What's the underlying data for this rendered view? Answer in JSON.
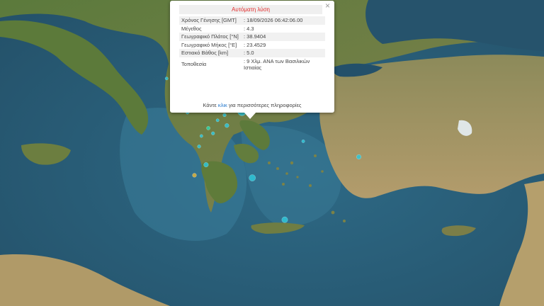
{
  "popup": {
    "title": "Αυτόματη λύση",
    "close_glyph": "×",
    "close_icon": "close-icon",
    "rows": [
      {
        "label": "Χρόνος Γένησης [GMT]",
        "value": ": 18/09/2026 06:42:06.00"
      },
      {
        "label": "Μέγεθος",
        "value": ": 4.3"
      },
      {
        "label": "Γεωγραφικό Πλάτος [°N]",
        "value": ": 38.9404"
      },
      {
        "label": "Γεωγραφικό Μήκος [°E]",
        "value": ": 23.4529"
      },
      {
        "label": "Εστιακό Βάθος [km]",
        "value": ": 5.0"
      },
      {
        "label": "Τοποθεσία",
        "value": ": 9 Χλμ. ΑΝΑ των Βασιλικών Ιστιαίας"
      }
    ],
    "more_prefix": "Κάντε ",
    "more_link": "κλικ",
    "more_suffix": " για περισσότερες πληροφορίες"
  },
  "map": {
    "colors": {
      "sea": "#3e6f88",
      "deep_sea": "#27506a",
      "land": "#5e7a3a",
      "land_light": "#a79c6e",
      "marker": "#2fc7d9",
      "marker_alt": "#e0b43c"
    },
    "markers": [
      {
        "lon": 23.4529,
        "lat": 38.9404,
        "mag": 4.3,
        "color": "#2fc7d9"
      },
      {
        "lon": 23.3,
        "lat": 39.3,
        "mag": 3.2,
        "color": "#2fc7d9"
      },
      {
        "lon": 23.6,
        "lat": 39.1,
        "mag": 3.8,
        "color": "#2fc7d9"
      },
      {
        "lon": 22.8,
        "lat": 38.4,
        "mag": 2.8,
        "color": "#2fc7d9"
      },
      {
        "lon": 22.2,
        "lat": 38.1,
        "mag": 2.6,
        "color": "#2fc7d9"
      },
      {
        "lon": 21.3,
        "lat": 39.2,
        "mag": 3.4,
        "color": "#31d6a8"
      },
      {
        "lon": 21.1,
        "lat": 38.9,
        "mag": 2.6,
        "color": "#2fc7d9"
      },
      {
        "lon": 20.8,
        "lat": 39.6,
        "mag": 2.5,
        "color": "#2fc7d9"
      },
      {
        "lon": 22.0,
        "lat": 38.3,
        "mag": 2.7,
        "color": "#31d6a8"
      },
      {
        "lon": 21.6,
        "lat": 37.6,
        "mag": 2.6,
        "color": "#2fc7d9"
      },
      {
        "lon": 21.9,
        "lat": 36.9,
        "mag": 3.0,
        "color": "#2fc7d9"
      },
      {
        "lon": 21.4,
        "lat": 36.5,
        "mag": 2.8,
        "color": "#e0b43c"
      },
      {
        "lon": 23.9,
        "lat": 36.4,
        "mag": 3.6,
        "color": "#2fc7d9"
      },
      {
        "lon": 25.3,
        "lat": 34.8,
        "mag": 3.4,
        "color": "#2fc7d9"
      },
      {
        "lon": 20.2,
        "lat": 40.2,
        "mag": 2.5,
        "color": "#2fc7d9"
      },
      {
        "lon": 24.2,
        "lat": 39.6,
        "mag": 3.2,
        "color": "#2fc7d9"
      },
      {
        "lon": 22.7,
        "lat": 38.8,
        "mag": 2.6,
        "color": "#2fc7d9"
      },
      {
        "lon": 22.4,
        "lat": 38.6,
        "mag": 2.5,
        "color": "#2fc7d9"
      },
      {
        "lon": 26.1,
        "lat": 37.8,
        "mag": 2.5,
        "color": "#2fc7d9"
      },
      {
        "lon": 28.5,
        "lat": 37.2,
        "mag": 3.0,
        "color": "#2fc7d9"
      },
      {
        "lon": 22.9,
        "lat": 39.6,
        "mag": 2.6,
        "color": "#2fc7d9"
      },
      {
        "lon": 21.7,
        "lat": 38.0,
        "mag": 2.5,
        "color": "#2fc7d9"
      }
    ]
  }
}
